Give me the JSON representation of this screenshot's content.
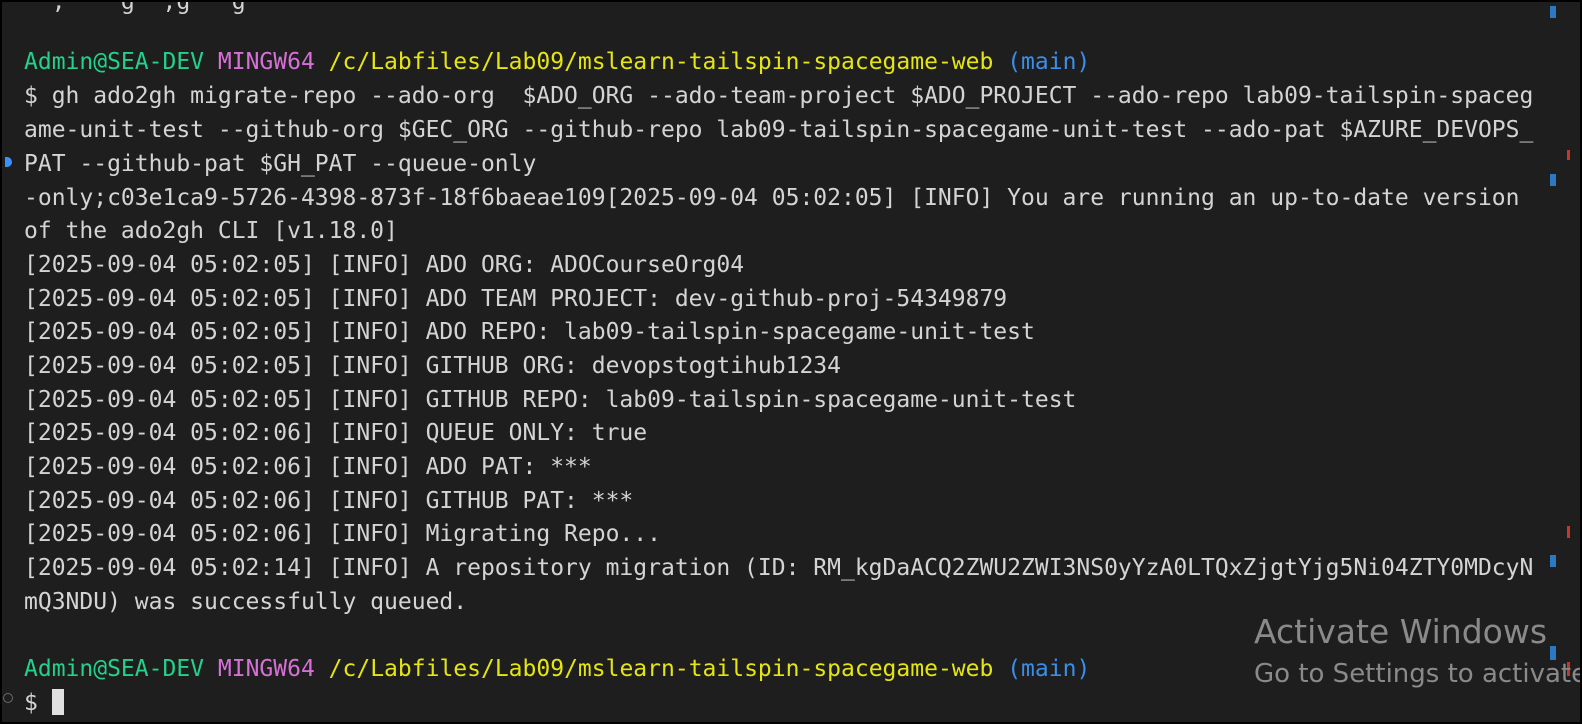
{
  "terminal": {
    "top_cut_line": "  ,    g  ,g   g",
    "prompt1": {
      "user": "Admin@SEA-DEV",
      "system": "MINGW64",
      "path": "/c/Labfiles/Lab09/mslearn-tailspin-spacegame-web",
      "branch": "(main)"
    },
    "command_lines": [
      "$ gh ado2gh migrate-repo --ado-org  $ADO_ORG --ado-team-project $ADO_PROJECT --ado-repo lab09-tailspin-spaceg",
      "ame-unit-test --github-org $GEC_ORG --github-repo lab09-tailspin-spacegame-unit-test --ado-pat $AZURE_DEVOPS_",
      "PAT --github-pat $GH_PAT --queue-only"
    ],
    "output_lines": [
      "-only;c03e1ca9-5726-4398-873f-18f6baeae109[2025-09-04 05:02:05] [INFO] You are running an up-to-date version",
      "of the ado2gh CLI [v1.18.0]",
      "[2025-09-04 05:02:05] [INFO] ADO ORG: ADOCourseOrg04",
      "[2025-09-04 05:02:05] [INFO] ADO TEAM PROJECT: dev-github-proj-54349879",
      "[2025-09-04 05:02:05] [INFO] ADO REPO: lab09-tailspin-spacegame-unit-test",
      "[2025-09-04 05:02:05] [INFO] GITHUB ORG: devopstogtihub1234",
      "[2025-09-04 05:02:05] [INFO] GITHUB REPO: lab09-tailspin-spacegame-unit-test",
      "[2025-09-04 05:02:06] [INFO] QUEUE ONLY: true",
      "[2025-09-04 05:02:06] [INFO] ADO PAT: ***",
      "[2025-09-04 05:02:06] [INFO] GITHUB PAT: ***",
      "[2025-09-04 05:02:06] [INFO] Migrating Repo...",
      "[2025-09-04 05:02:14] [INFO] A repository migration (ID: RM_kgDaACQ2ZWU2ZWI3NS0yYzA0LTQxZjgtYjg5Ni04ZTY0MDcyN",
      "mQ3NDU) was successfully queued."
    ],
    "prompt2": {
      "user": "Admin@SEA-DEV",
      "system": "MINGW64",
      "path": "/c/Labfiles/Lab09/mslearn-tailspin-spacegame-web",
      "branch": "(main)"
    },
    "input_prompt": "$"
  },
  "watermark": {
    "title": "Activate Windows",
    "subtitle": "Go to Settings to activate"
  },
  "colors": {
    "background": "#1e1e1e",
    "user": "#23d18b",
    "system": "#d670d6",
    "path": "#e5e510",
    "branch": "#3b8eea"
  }
}
